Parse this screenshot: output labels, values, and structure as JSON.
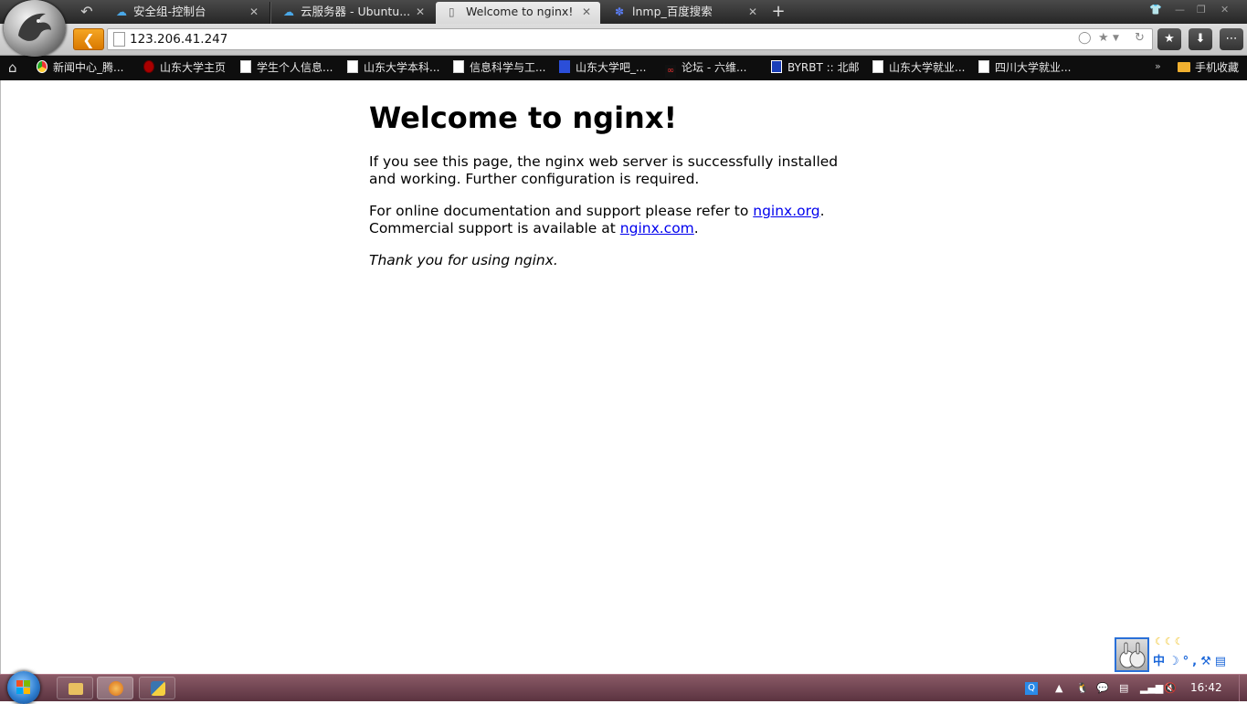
{
  "browser": {
    "tabs": [
      {
        "label": "安全组-控制台",
        "icon": "cloud-icon",
        "active": false
      },
      {
        "label": "云服务器 - Ubuntu...",
        "icon": "cloud-icon",
        "active": false
      },
      {
        "label": "Welcome to nginx!",
        "icon": "page-icon",
        "active": true
      },
      {
        "label": "lnmp_百度搜索",
        "icon": "baidu-paw-icon",
        "active": false
      }
    ],
    "url": "123.206.41.247"
  },
  "bookmarks": [
    {
      "label": "新闻中心_腾..."
    },
    {
      "label": "山东大学主页"
    },
    {
      "label": "学生个人信息..."
    },
    {
      "label": "山东大学本科..."
    },
    {
      "label": "信息科学与工..."
    },
    {
      "label": "山东大学吧_..."
    },
    {
      "label": "论坛 - 六维..."
    },
    {
      "label": "BYRBT :: 北邮"
    },
    {
      "label": "山东大学就业..."
    },
    {
      "label": "四川大学就业..."
    }
  ],
  "bookmarks_more_folder": "手机收藏",
  "page": {
    "heading": "Welcome to nginx!",
    "p1": "If you see this page, the nginx web server is successfully installed and working. Further configuration is required.",
    "p2_prefix": "For online documentation and support please refer to ",
    "link1": "nginx.org",
    "p2_mid": ". Commercial support is available at ",
    "link2": "nginx.com",
    "p2_suffix": ".",
    "p3": "Thank you for using nginx."
  },
  "ime": {
    "mode": "中"
  },
  "taskbar": {
    "clock": "16:42"
  }
}
